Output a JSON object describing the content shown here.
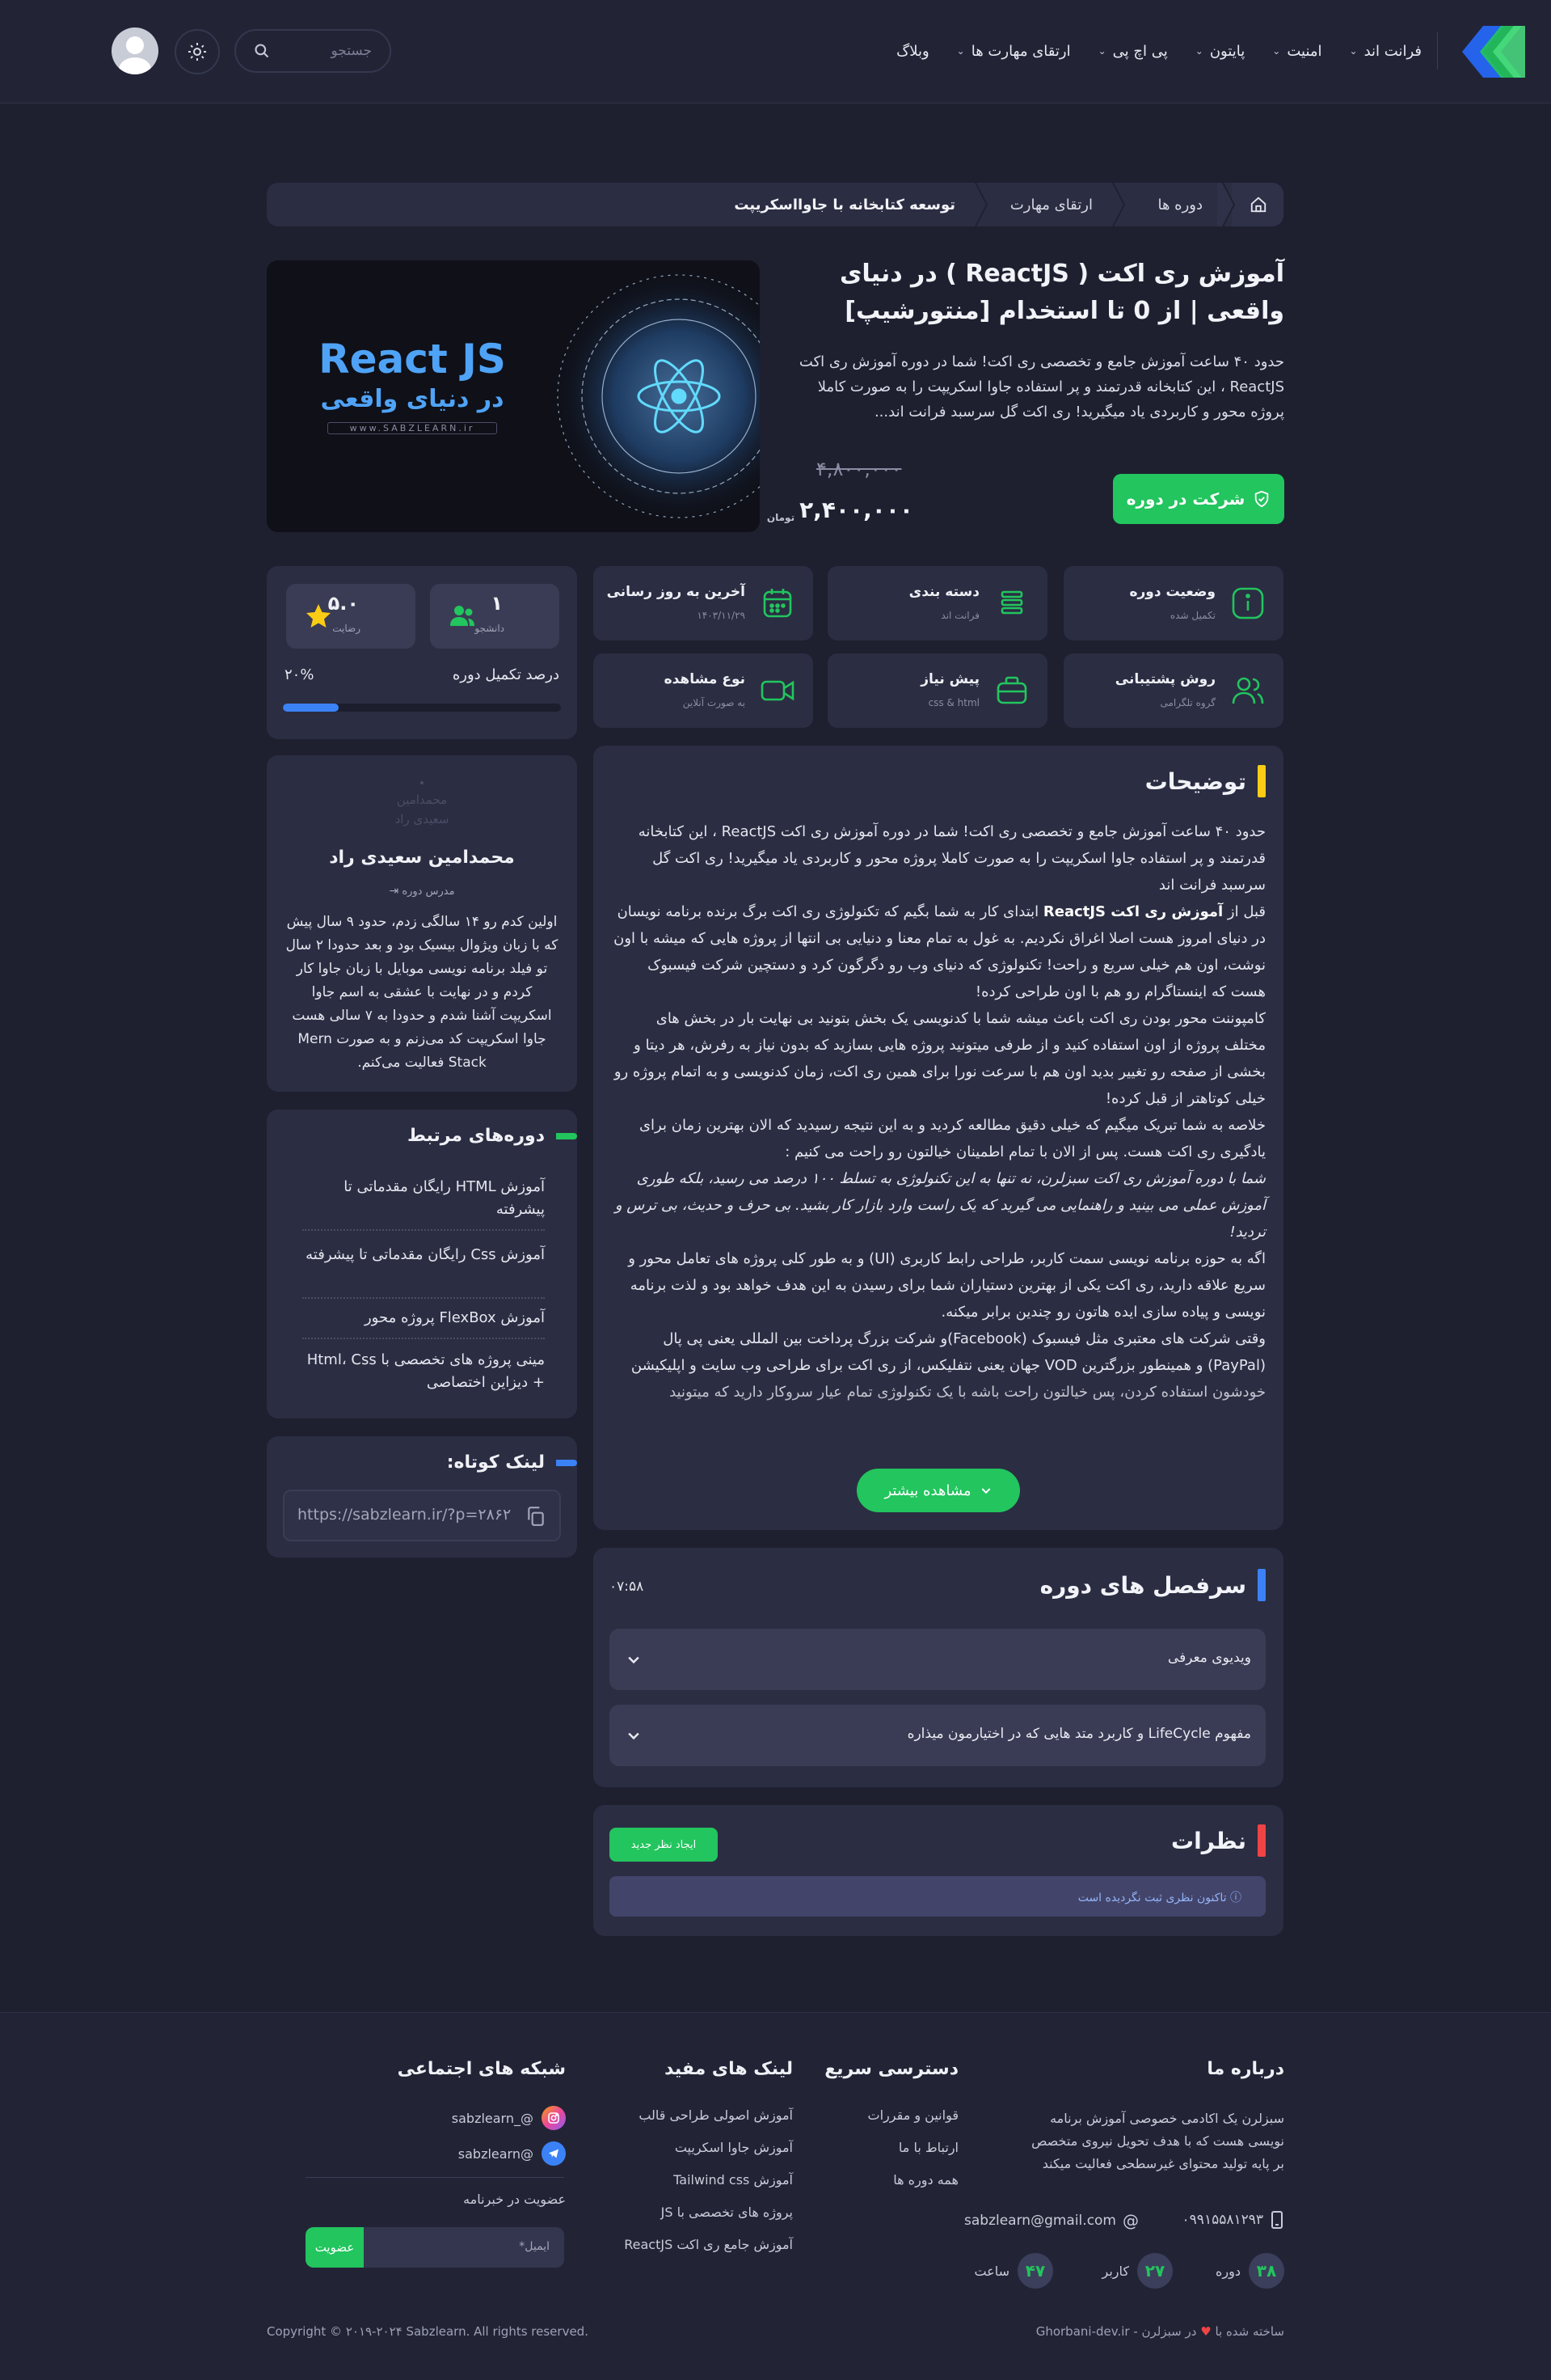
{
  "nav": {
    "items": [
      {
        "label": "فرانت اند",
        "dropdown": true
      },
      {
        "label": "امنیت",
        "dropdown": true
      },
      {
        "label": "پایتون",
        "dropdown": true
      },
      {
        "label": "پی اچ پی",
        "dropdown": true
      },
      {
        "label": "ارتقای مهارت ها",
        "dropdown": true
      },
      {
        "label": "وبلاگ",
        "dropdown": false
      }
    ],
    "search_placeholder": "جستجو",
    "icons": {
      "search": "search-icon",
      "theme": "sun-icon",
      "avatar": "user-avatar"
    }
  },
  "breadcrumb": [
    "دوره ها",
    "ارتقای مهارت",
    "توسعه کتابخانه با جاوااسکریپت"
  ],
  "course": {
    "title": "آموزش ری اکت ( ReactJS ) در دنیای واقعی | از 0 تا استخدام [منتورشیپ]",
    "description": "حدود ۴۰ ساعت آموزش جامع و تخصصی ری اکت!  شما در دوره آموزش ری اکت ReactJS ، این کتابخانه قدرتمند و پر استفاده جاوا اسکریپت را به صورت کاملا پروژه محور و کاربردی یاد میگیرید! ری اکت گل سرسبد فرانت اند...",
    "enroll_label": "شرکت در دوره",
    "old_price": "۴,۸۰۰,۰۰۰",
    "new_price": "۲,۴۰۰,۰۰۰",
    "currency": "تومان",
    "banner_title": "React JS",
    "banner_subtitle": "در دنیای واقعی",
    "banner_url": "www.SABZLEARN.ir"
  },
  "info_cards": [
    {
      "title": "وضعیت دوره",
      "sub": "تکمیل شده",
      "icon": "info-icon",
      "color": "#22c55e"
    },
    {
      "title": "دسته بندی",
      "sub": "فرانت اند",
      "icon": "layers-icon",
      "color": "#22c55e"
    },
    {
      "title": "آخرین به روز رسانی",
      "sub": "۱۴۰۳/۱۱/۲۹",
      "icon": "calendar-icon",
      "color": "#22c55e"
    },
    {
      "title": "روش پشتیبانی",
      "sub": "گروه تلگرامی",
      "icon": "users-icon",
      "color": "#22c55e"
    },
    {
      "title": "پیش نیاز",
      "sub": "css & html",
      "icon": "briefcase-icon",
      "color": "#22c55e"
    },
    {
      "title": "نوع مشاهده",
      "sub": "به صورت آنلاین",
      "icon": "video-icon",
      "color": "#22c55e"
    }
  ],
  "stats": {
    "students_value": "۱",
    "students_label": "دانشجو",
    "rating_value": "۵.۰",
    "rating_label": "رضایت",
    "progress_label": "درصد تکمیل دوره",
    "progress_text": "۲۰%",
    "progress_value": 0.2
  },
  "description": {
    "title": "توضیحات",
    "more_label": "مشاهده بیشتر"
  },
  "teacher": {
    "ghost_name": "محمدامین",
    "ghost_family": "سعیدی راد",
    "name": "محمدامین سعیدی راد",
    "role": "مدرس دوره",
    "bio": "اولین کدم رو ۱۴ سالگی زدم، حدود ۹ سال پیش که با زبان ویژوال بیسیک بود و بعد حدودا ۲ سال تو فیلد برنامه نویسی موبایل با زبان جاوا کار کردم و در نهایت با عشقی به اسم جاوا اسکریپت آشنا شدم و حدودا به ۷ سالی هست جاوا اسکریپت کد می‌زنم و به صورت Mern Stack فعالیت می‌کنم."
  },
  "related": {
    "title": "دوره‌های مرتبط",
    "items": [
      "آموزش HTML رایگان مقدماتی تا پیشرفته",
      "آموزش Css رایگان مقدماتی تا پیشرفته",
      "آموزش FlexBox پروژه محور",
      "مینی پروژه های تخصصی با Html، Css + دیزاین اختصاصی"
    ]
  },
  "short_link": {
    "title": "لینک کوتاه:",
    "url": "https://sabzlearn.ir/?p=۲۸۶۲"
  },
  "chapters": {
    "title": "سرفصل های دوره",
    "duration": "۰۷:۵۸",
    "items": [
      "ویدیوی معرفی",
      "مفهوم LifeCycle و کاربرد متد هایی که در اختیارمون میذاره"
    ]
  },
  "comments": {
    "title": "نظرات",
    "new_label": "ایجاد نظر جدید",
    "empty_text": "ⓘ تاکنون نظری ثبت نگردیده است"
  },
  "footer": {
    "about_title": "درباره ما",
    "about_text": "سبزلرن یک اکادمی خصوصی آموزش برنامه نویسی هست که با هدف تحویل نیروی متخصص بر پایه تولید محتوای غیرسطحی فعالیت میکند",
    "phone": "۰۹۹۱۵۵۸۱۲۹۳",
    "email": "sabzlearn@gmail.com",
    "stats": [
      {
        "value": "۳۸",
        "label": "دوره"
      },
      {
        "value": "۲۷",
        "label": "کاربر"
      },
      {
        "value": "۴۷",
        "label": "ساعت"
      }
    ],
    "quick_title": "دسترسی سریع",
    "quick_links": [
      "قوانین و مقررات",
      "ارتباط با ما",
      "همه دوره ها"
    ],
    "useful_title": "لینک های مفید",
    "useful_links": [
      "آموزش اصولی طراحی قالب",
      "آموزش جاوا اسکریپت",
      "آموزش Tailwind css",
      "پروژه های تخصصی با JS",
      "آموزش جامع ری اکت ReactJS"
    ],
    "social_title": "شبکه های اجتماعی",
    "social": [
      {
        "handle": "sabzlearn_@",
        "icon": "instagram-icon"
      },
      {
        "handle": "sabzlearn@",
        "icon": "telegram-icon"
      }
    ],
    "newsletter_label": "عضویت در خبرنامه",
    "newsletter_placeholder": "ایمیل*",
    "newsletter_button": "عضویت",
    "made_by": "ساخته شده با",
    "made_by_suffix": "در سبزلرن - Ghorbani-dev.ir",
    "copyright": "Copyright © ۲۰۱۹-۲۰۲۴ Sabzlearn. All rights reserved."
  },
  "colors": {
    "accent": "#22c55e",
    "blue": "#3b82f6",
    "yellow": "#facc15",
    "red": "#ef4444",
    "bg": "#1e2030",
    "card": "#2b2d42"
  }
}
